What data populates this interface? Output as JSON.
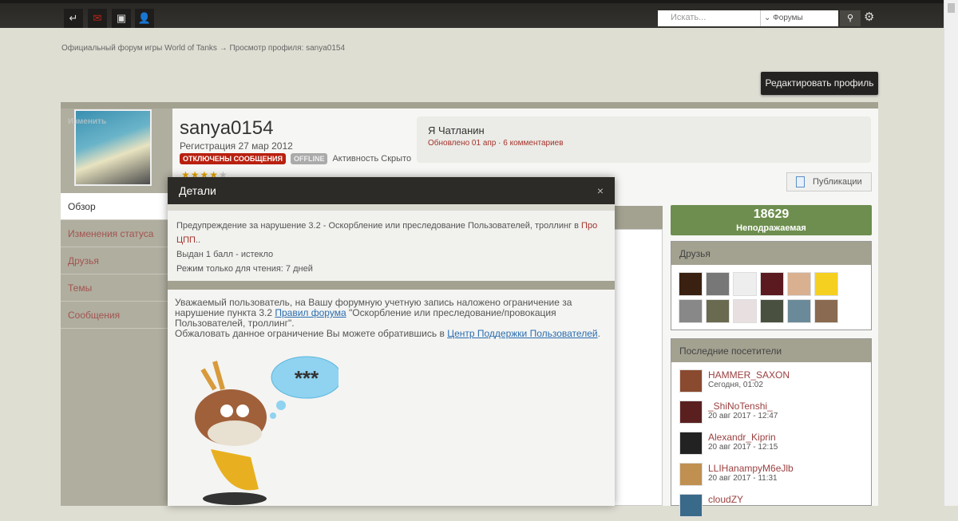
{
  "topbar": {
    "search_placeholder": "Искать...",
    "scope": "Форумы",
    "icons": [
      "sign-out-icon",
      "mail-icon",
      "contacts-icon",
      "user-icon"
    ]
  },
  "breadcrumb": {
    "home": "Официальный форум игры World of Tanks",
    "sep": "→",
    "current": "Просмотр профиля: sanya0154"
  },
  "edit_profile": "Редактировать профиль",
  "profile": {
    "avatar_change": "Изменить",
    "username": "sanya0154",
    "registered": "Регистрация 27 мар 2012",
    "badge_messages": "ОТКЛЮЧЕНЫ СООБЩЕНИЯ",
    "badge_status": "OFFLINE",
    "activity": "Активность Скрыто",
    "rating_stars": 4,
    "status_text": "Я Чатланин",
    "status_updated": "Обновлено 01 апр · 6 комментариев",
    "publications": "Публикации"
  },
  "nav": [
    "Обзор",
    "Изменения статуса",
    "Друзья",
    "Темы",
    "Сообщения"
  ],
  "reputation": {
    "value": "18629",
    "label": "Неподражаемая",
    "color": "#6d8e4e"
  },
  "friends": {
    "title": "Друзья",
    "count": 12
  },
  "visitors": {
    "title": "Последние посетители",
    "items": [
      {
        "name": "HAMMER_SAXON",
        "date": "Сегодня, 01:02"
      },
      {
        "name": "_ShiNoTenshi_",
        "date": "20 авг 2017 - 12:47"
      },
      {
        "name": "Alexandr_Kiprin",
        "date": "20 авг 2017 - 12:15"
      },
      {
        "name": "LLIHanampyM6eJlb",
        "date": "20 авг 2017 - 11:31"
      },
      {
        "name": "cloudZY",
        "date": ""
      }
    ]
  },
  "dialog": {
    "title": "Детали",
    "close": "×",
    "warning_pre": "Предупреждение за нарушение 3.2 - Оскорбление или преследование Пользователей, троллинг в ",
    "warning_link": "Про ЦПП",
    "warning_post": "..",
    "points": "Выдан 1 балл - истекло",
    "readonly": "Режим только для чтения: 7 дней",
    "msg1": "Уважаемый пользователь, на Вашу форумную учетную запись наложено ограничение за нарушение пункта 3.2 ",
    "msg_link1": "Правил форума",
    "msg2": " \"Оскорбление или преследование/провокация Пользователей, троллинг\".",
    "msg3": "Обжаловать данное ограничение Вы можете обратившись в ",
    "msg_link2": "Центр Поддержки Пользователей",
    "msg4": ".",
    "bubble": "***"
  }
}
